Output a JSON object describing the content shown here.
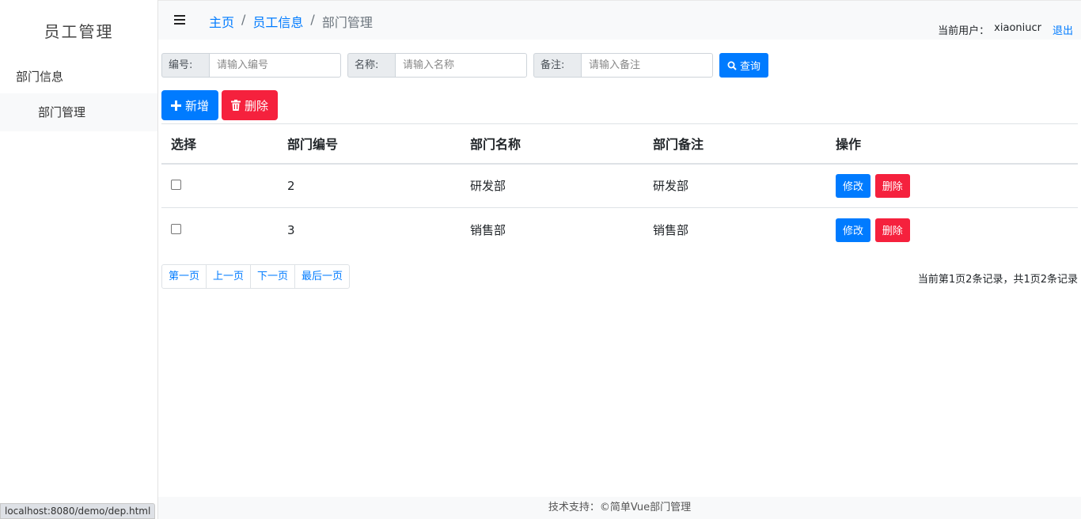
{
  "sidebar": {
    "brand": "员工管理",
    "group_label": "部门信息",
    "items": [
      {
        "label": "部门管理"
      }
    ]
  },
  "header": {
    "breadcrumb": [
      "主页",
      "员工信息",
      "部门管理"
    ],
    "separator": "/",
    "user_label": "当前用户：",
    "username": "xiaoniucr",
    "logout": "退出"
  },
  "filters": {
    "id_label": "编号:",
    "id_placeholder": "请输入编号",
    "name_label": "名称:",
    "name_placeholder": "请输入名称",
    "remark_label": "备注:",
    "remark_placeholder": "请输入备注",
    "query_button": "查询"
  },
  "actions": {
    "add_button": "新增",
    "delete_button": "删除"
  },
  "table": {
    "headers": [
      "选择",
      "部门编号",
      "部门名称",
      "部门备注",
      "操作"
    ],
    "rows": [
      {
        "id": "2",
        "name": "研发部",
        "remark": "研发部",
        "edit": "修改",
        "delete": "删除"
      },
      {
        "id": "3",
        "name": "销售部",
        "remark": "销售部",
        "edit": "修改",
        "delete": "删除"
      }
    ]
  },
  "pagination": {
    "first": "第一页",
    "prev": "上一页",
    "next": "下一页",
    "last": "最后一页",
    "info": "当前第1页2条记录，共1页2条记录"
  },
  "footer": {
    "text": "技术支持：©简单Vue部门管理"
  },
  "statusbar": {
    "url": "localhost:8080/demo/dep.html"
  },
  "colors": {
    "primary": "#007bff",
    "danger": "#f5213d"
  }
}
